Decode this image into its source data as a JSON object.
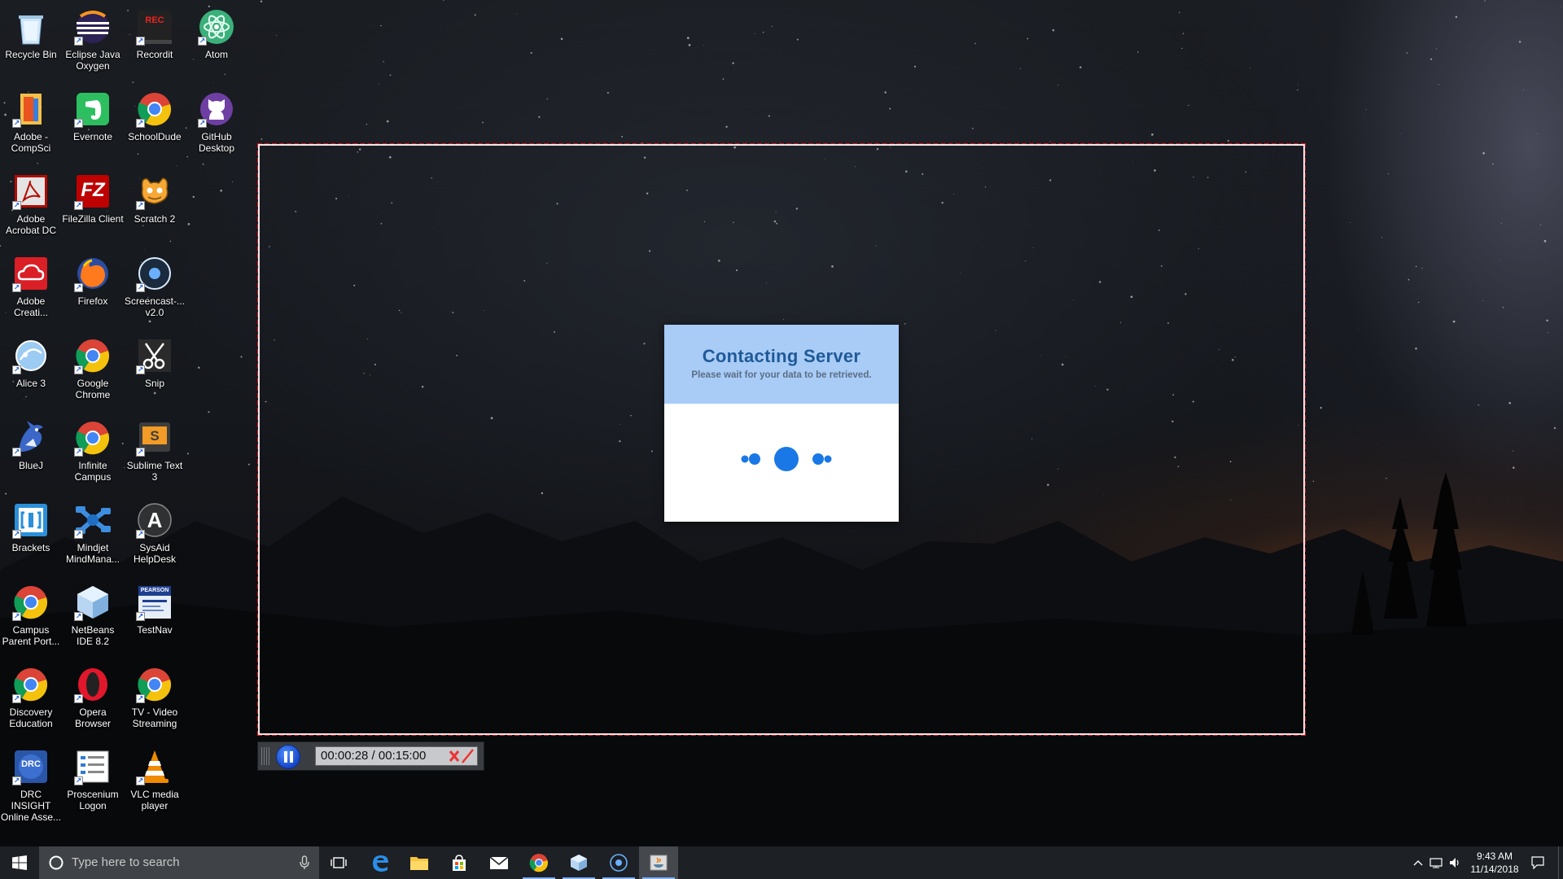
{
  "desktop": {
    "icons": [
      {
        "label": "Recycle Bin",
        "icon": "recycle-bin-icon"
      },
      {
        "label": "Eclipse Java Oxygen",
        "icon": "eclipse-icon"
      },
      {
        "label": "Recordit",
        "icon": "recordit-icon",
        "badge": "REC"
      },
      {
        "label": "Atom",
        "icon": "atom-icon"
      },
      {
        "label": "Adobe - CompSci",
        "icon": "folder-icon"
      },
      {
        "label": "Evernote",
        "icon": "evernote-icon"
      },
      {
        "label": "SchoolDude",
        "icon": "chrome-icon"
      },
      {
        "label": "GitHub Desktop",
        "icon": "github-icon"
      },
      {
        "label": "Adobe Acrobat DC",
        "icon": "acrobat-icon"
      },
      {
        "label": "FileZilla Client",
        "icon": "filezilla-icon",
        "badge": "FZ"
      },
      {
        "label": "Scratch 2",
        "icon": "scratch-icon"
      },
      {
        "label": "Adobe Creati...",
        "icon": "creative-cloud-icon"
      },
      {
        "label": "Firefox",
        "icon": "firefox-icon"
      },
      {
        "label": "Screencast-... v2.0",
        "icon": "screencast-icon"
      },
      {
        "label": "Alice 3",
        "icon": "alice-icon"
      },
      {
        "label": "Google Chrome",
        "icon": "chrome-icon"
      },
      {
        "label": "Snip",
        "icon": "scissors-icon"
      },
      {
        "label": "BlueJ",
        "icon": "bluej-icon"
      },
      {
        "label": "Infinite Campus",
        "icon": "chrome-icon"
      },
      {
        "label": "Sublime Text 3",
        "icon": "sublime-icon",
        "badge": "S"
      },
      {
        "label": "Brackets",
        "icon": "brackets-icon"
      },
      {
        "label": "Mindjet MindMana...",
        "icon": "mindjet-icon"
      },
      {
        "label": "SysAid HelpDesk",
        "icon": "sysaid-icon",
        "badge": "A"
      },
      {
        "label": "Campus Parent Port...",
        "icon": "chrome-icon"
      },
      {
        "label": "NetBeans IDE 8.2",
        "icon": "netbeans-icon"
      },
      {
        "label": "TestNav",
        "icon": "testnav-icon",
        "badge": "PEARSON"
      },
      {
        "label": "Discovery Education",
        "icon": "chrome-icon"
      },
      {
        "label": "Opera Browser",
        "icon": "opera-icon"
      },
      {
        "label": "TV - Video Streaming",
        "icon": "chrome-icon"
      },
      {
        "label": "DRC INSIGHT Online Asse...",
        "icon": "drc-insight-icon",
        "badge": "DRC"
      },
      {
        "label": "Proscenium Logon",
        "icon": "proscenium-icon"
      },
      {
        "label": "VLC media player",
        "icon": "vlc-icon"
      }
    ]
  },
  "dialog": {
    "title": "Contacting Server",
    "subtitle": "Please wait for your data to be retrieved."
  },
  "recorder": {
    "elapsed": "00:00:28",
    "limit": "00:15:00",
    "time_display": "00:00:28 / 00:15:00"
  },
  "taskbar": {
    "search_placeholder": "Type here to search",
    "pinned": [
      "task-view-icon",
      "edge-icon",
      "file-explorer-icon",
      "store-icon",
      "mail-icon",
      "chrome-icon",
      "netbeans-icon",
      "screencast-icon",
      "java-app-icon"
    ],
    "time": "9:43 AM",
    "date": "11/14/2018"
  },
  "colors": {
    "dialog_header": "#a9ccf7",
    "dialog_title": "#1f5a97",
    "spinner": "#1a78e6",
    "frame_dash": "#e0141e",
    "taskbar": "#1d2024"
  }
}
